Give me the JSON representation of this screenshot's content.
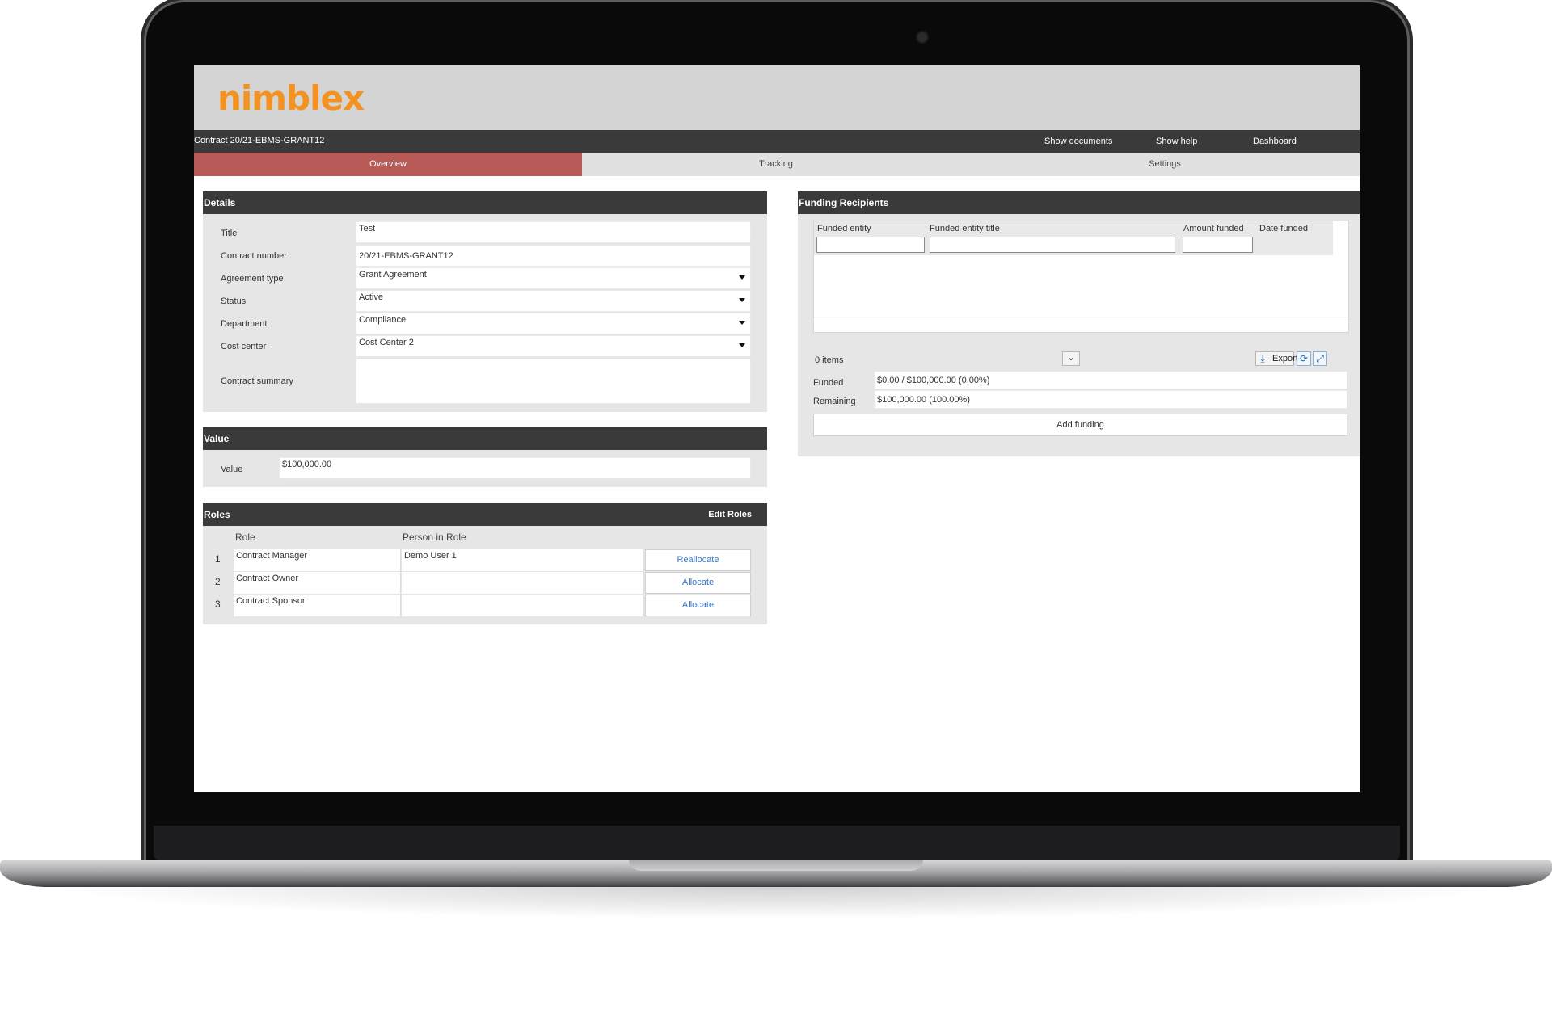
{
  "app": {
    "logo": "nimblex"
  },
  "navbar": {
    "title": "Contract 20/21-EBMS-GRANT12",
    "links": [
      "Show documents",
      "Show help",
      "Dashboard"
    ]
  },
  "tabs": [
    "Overview",
    "Tracking",
    "Settings"
  ],
  "details": {
    "heading": "Details",
    "fields": [
      {
        "label": "Title",
        "value": "Test"
      },
      {
        "label": "Contract number",
        "value": "20/21-EBMS-GRANT12"
      },
      {
        "label": "Agreement type",
        "value": "Grant Agreement"
      },
      {
        "label": "Status",
        "value": "Active"
      },
      {
        "label": "Department",
        "value": "Compliance"
      },
      {
        "label": "Cost center",
        "value": "Cost Center 2"
      },
      {
        "label": "Contract summary",
        "value": ""
      }
    ]
  },
  "value_panel": {
    "heading": "Value",
    "label": "Value",
    "value": "$100,000.00"
  },
  "roles": {
    "heading": "Roles",
    "edit_label": "Edit Roles",
    "columns": [
      "Role",
      "Person in Role"
    ],
    "rows": [
      {
        "num": "1",
        "role": "Contract Manager",
        "person": "Demo User 1",
        "action": "Reallocate"
      },
      {
        "num": "2",
        "role": "Contract Owner",
        "person": "",
        "action": "Allocate"
      },
      {
        "num": "3",
        "role": "Contract Sponsor",
        "person": "",
        "action": "Allocate"
      }
    ]
  },
  "funding": {
    "heading": "Funding Recipients",
    "columns": [
      "Funded entity",
      "Funded entity title",
      "Amount funded",
      "Date funded"
    ],
    "items_count": "0 items",
    "export_label": "Export",
    "funded_label": "Funded",
    "funded_value": "$0.00 / $100,000.00 (0.00%)",
    "remaining_label": "Remaining",
    "remaining_value": "$100,000.00 (100.00%)",
    "add_label": "Add funding"
  },
  "colors": {
    "logo": "#f39221",
    "active_tab": "#b85a58",
    "header_dark": "#3a3a3a",
    "link": "#3a78c9"
  }
}
